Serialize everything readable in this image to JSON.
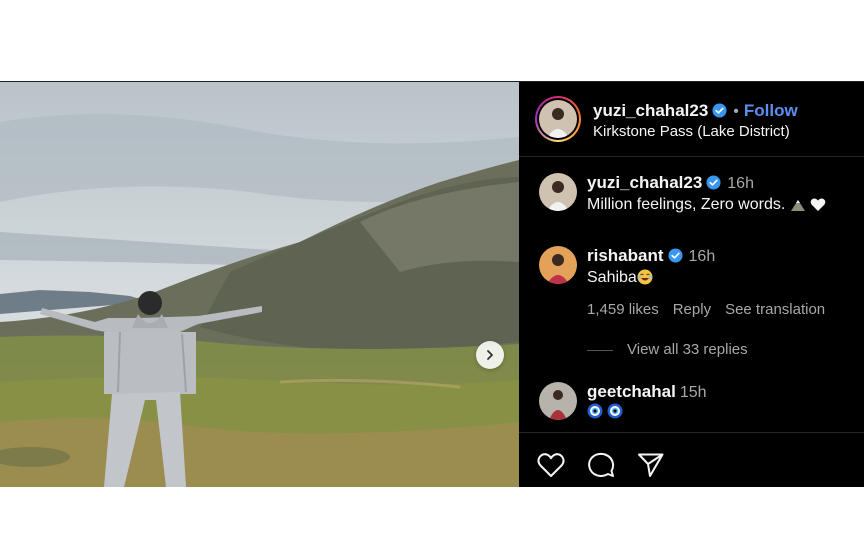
{
  "post": {
    "author": {
      "username": "yuzi_chahal23",
      "follow_label": "Follow",
      "location": "Kirkstone Pass (Lake District)"
    },
    "comments": [
      {
        "username": "yuzi_chahal23",
        "time": "16h",
        "text": "Million feelings, Zero words.",
        "verified": true
      },
      {
        "username": "rishabant",
        "time": "16h",
        "text": "Sahiba",
        "verified": true,
        "likes": "1,459 likes",
        "reply_label": "Reply",
        "translate_label": "See translation",
        "view_replies": "View all 33 replies"
      },
      {
        "username": "geetchahal",
        "time": "15h",
        "text": "",
        "verified": false
      }
    ],
    "icons": [
      "verified-badge-icon",
      "chevron-right-icon",
      "heart-icon",
      "comment-icon",
      "share-icon",
      "mountain-emoji",
      "white-heart-emoji",
      "laughing-emoji",
      "evil-eye-emoji"
    ]
  },
  "colors": {
    "background": "#000000",
    "accent": "#5b8ef0",
    "secondary_text": "#a8a8a8",
    "verified": "#3897f0"
  }
}
